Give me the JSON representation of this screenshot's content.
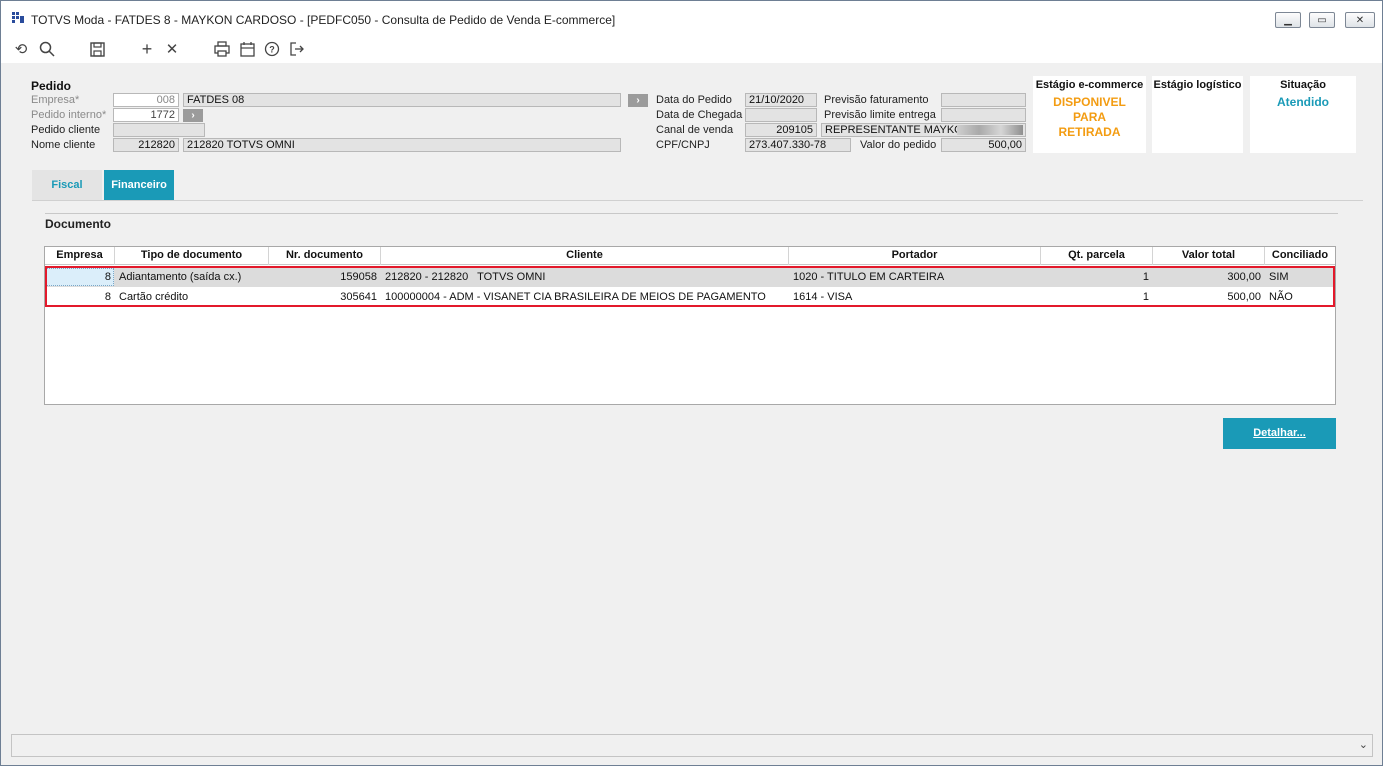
{
  "window": {
    "title": "TOTVS Moda - FATDES 8 - MAYKON CARDOSO - [PEDFC050 - Consulta de Pedido de Venda E-commerce]"
  },
  "toolbar": {
    "icons": [
      "undo-icon",
      "search-icon",
      "save-icon",
      "add-icon",
      "close-icon",
      "print-icon",
      "calendar-icon",
      "help-icon",
      "exit-icon"
    ]
  },
  "pedido": {
    "section_title": "Pedido",
    "empresa_label": "Empresa*",
    "empresa_code": "008",
    "empresa_name": "FATDES 08",
    "pedido_interno_label": "Pedido interno*",
    "pedido_interno": "1772",
    "pedido_cliente_label": "Pedido cliente",
    "pedido_cliente": "",
    "nome_cliente_label": "Nome cliente",
    "nome_cliente_code": "212820",
    "nome_cliente_name": "212820   TOTVS OMNI",
    "data_pedido_label": "Data do Pedido",
    "data_pedido": "21/10/2020",
    "data_chegada_label": "Data de Chegada",
    "data_chegada": "",
    "canal_venda_label": "Canal de venda",
    "canal_venda_code": "209105",
    "canal_venda_name": "REPRESENTANTE MAYKON",
    "cpf_label": "CPF/CNPJ",
    "cpf": "273.407.330-78",
    "prev_fat_label": "Previsão faturamento",
    "prev_fat": "",
    "prev_limite_label": "Previsão limite entrega",
    "prev_limite": "",
    "valor_pedido_label": "Valor do pedido",
    "valor_pedido": "500,00"
  },
  "stages": {
    "ecommerce_title": "Estágio e-commerce",
    "ecommerce_value": "DISPONIVEL PARA RETIRADA",
    "logistico_title": "Estágio logístico",
    "logistico_value": "",
    "situacao_title": "Situação",
    "situacao_value": "Atendido"
  },
  "tabs": {
    "fiscal": "Fiscal",
    "financeiro": "Financeiro"
  },
  "documento": {
    "section_title": "Documento",
    "columns": [
      "Empresa",
      "Tipo de documento",
      "Nr. documento",
      "Cliente",
      "Portador",
      "Qt. parcela",
      "Valor total",
      "Conciliado"
    ],
    "rows": [
      [
        "8",
        "Adiantamento (saída cx.)",
        "159058",
        "212820 - 212820   TOTVS OMNI",
        "1020 - TITULO EM CARTEIRA",
        "1",
        "300,00",
        "SIM"
      ],
      [
        "8",
        "Cartão crédito",
        "305641",
        "100000004 - ADM - VISANET CIA BRASILEIRA DE MEIOS DE PAGAMENTO",
        "1614 - VISA",
        "1",
        "500,00",
        "NÃO"
      ]
    ]
  },
  "buttons": {
    "detalhar": "Detalhar..."
  },
  "colors": {
    "accent": "#1a9ab7",
    "orange": "#f39c12",
    "highlight": "#e3192b"
  }
}
